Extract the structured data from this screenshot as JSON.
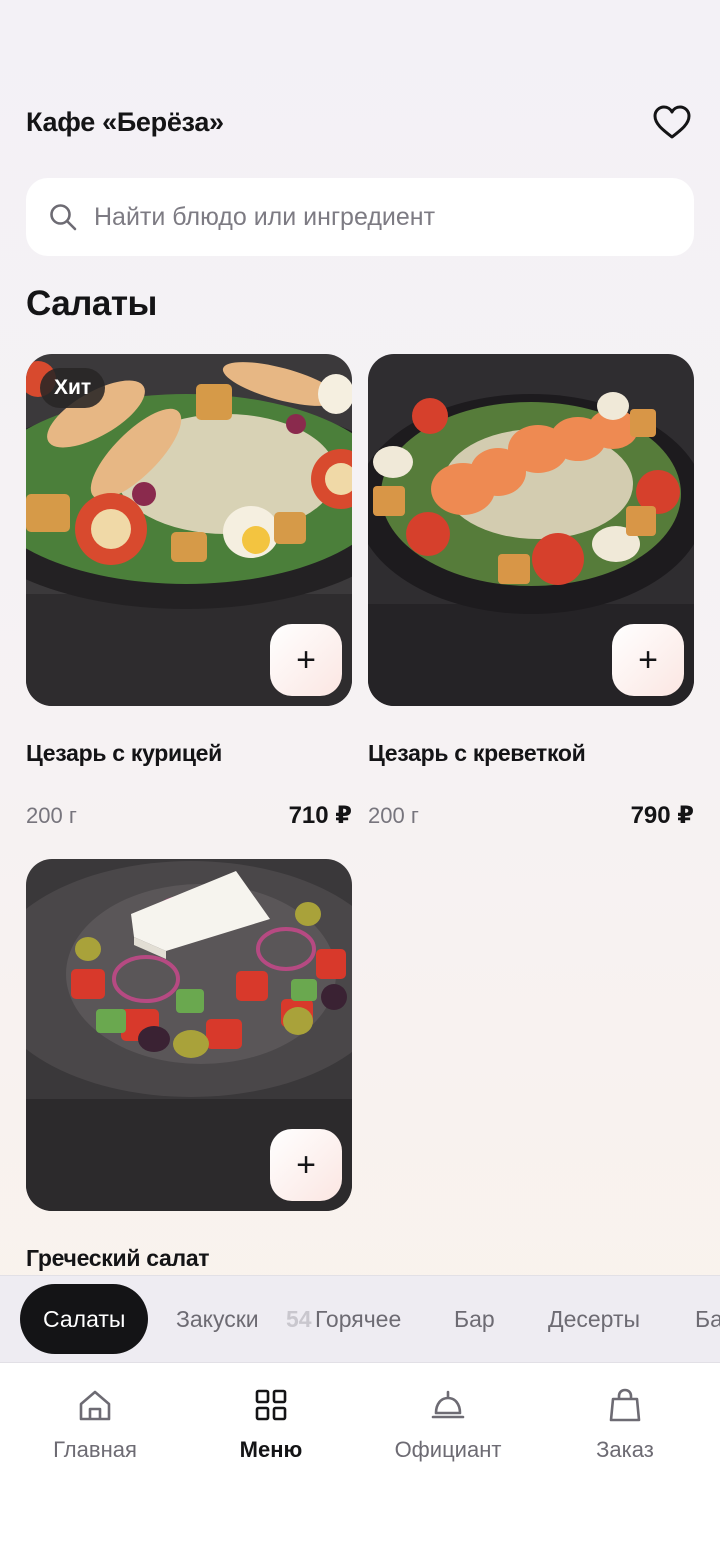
{
  "header": {
    "title": "Кафе «Берёза»",
    "favorite_icon": "heart-icon"
  },
  "search": {
    "placeholder": "Найти блюдо или ингредиент",
    "icon": "search-icon"
  },
  "section": {
    "title": "Салаты"
  },
  "dishes": [
    {
      "name": "Цезарь с курицей",
      "weight": "200 г",
      "price": "710 ₽",
      "badge": "Хит",
      "add_label": "+"
    },
    {
      "name": "Цезарь с креветкой",
      "weight": "200 г",
      "price": "790 ₽",
      "add_label": "+"
    },
    {
      "name": "Греческий салат",
      "add_label": "+"
    }
  ],
  "categories": {
    "items": [
      "Салаты",
      "Закуски",
      "Горячее",
      "Бар",
      "Десерты",
      "Ба"
    ],
    "active_index": 0,
    "overlay_text": "54"
  },
  "tabbar": {
    "items": [
      {
        "label": "Главная",
        "icon": "home-icon"
      },
      {
        "label": "Меню",
        "icon": "grid-menu-icon"
      },
      {
        "label": "Официант",
        "icon": "service-bell-icon"
      },
      {
        "label": "Заказ",
        "icon": "shopping-bag-icon"
      }
    ],
    "active_index": 1
  },
  "colors": {
    "accent": "#141416",
    "background": "#f3f1f6",
    "muted_text": "#6d6b73"
  }
}
